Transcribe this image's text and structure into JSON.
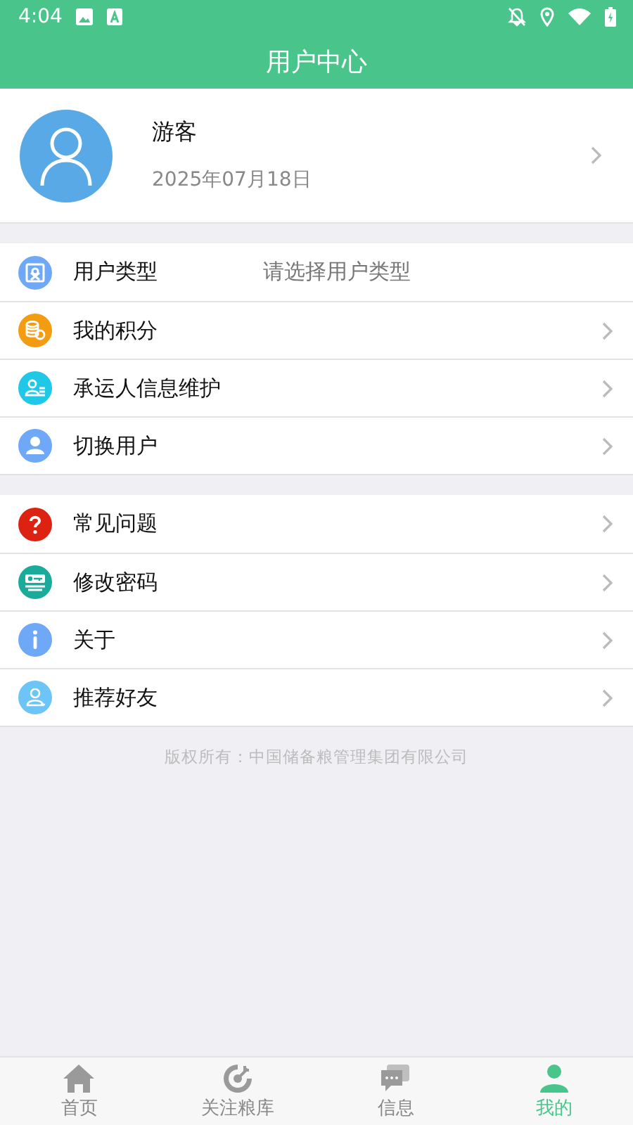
{
  "status_bar": {
    "time": "4:04"
  },
  "header": {
    "title": "用户中心"
  },
  "profile": {
    "name": "游客",
    "date": "2025年07月18日"
  },
  "groups": [
    {
      "items": [
        {
          "kind": "id-card",
          "color": "#6ea8f7",
          "label": "用户类型",
          "value": "请选择用户类型"
        },
        {
          "kind": "coins",
          "color": "#f39c12",
          "label": "我的积分"
        },
        {
          "kind": "person-list",
          "color": "#1fc8e6",
          "label": "承运人信息维护"
        },
        {
          "kind": "person",
          "color": "#6ea8f7",
          "label": "切换用户"
        }
      ]
    },
    {
      "items": [
        {
          "kind": "question",
          "color": "#dd2211",
          "label": "常见问题"
        },
        {
          "kind": "key",
          "color": "#1aab9b",
          "label": "修改密码"
        },
        {
          "kind": "info",
          "color": "#6ea8f7",
          "label": "关于"
        },
        {
          "kind": "person-add",
          "color": "#6cc4f7",
          "label": "推荐好友"
        }
      ]
    }
  ],
  "copyright": "版权所有：中国储备粮管理集团有限公司",
  "tabs": [
    {
      "kind": "home",
      "label": "首页",
      "selected": false
    },
    {
      "kind": "target",
      "label": "关注粮库",
      "selected": false
    },
    {
      "kind": "chat",
      "label": "信息",
      "selected": false
    },
    {
      "kind": "person",
      "label": "我的",
      "selected": true
    }
  ]
}
